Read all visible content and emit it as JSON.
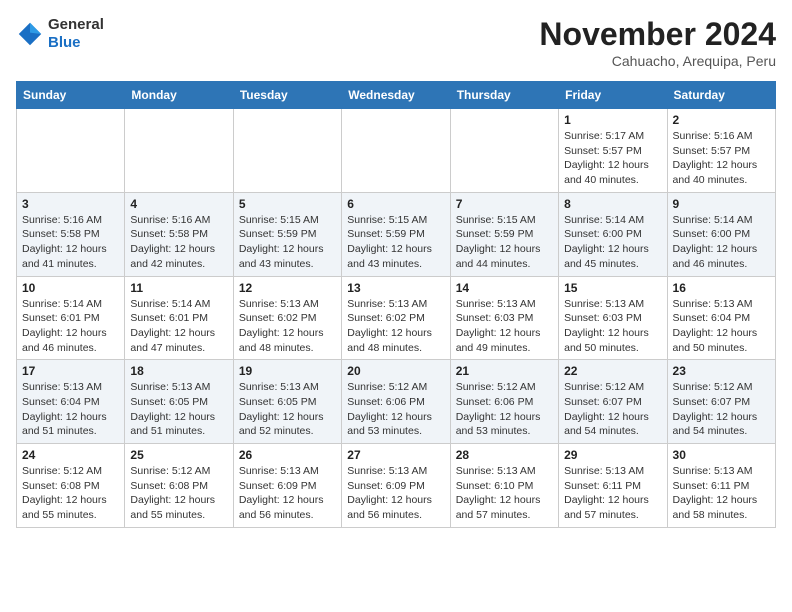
{
  "header": {
    "logo_general": "General",
    "logo_blue": "Blue",
    "month_year": "November 2024",
    "location": "Cahuacho, Arequipa, Peru"
  },
  "days_of_week": [
    "Sunday",
    "Monday",
    "Tuesday",
    "Wednesday",
    "Thursday",
    "Friday",
    "Saturday"
  ],
  "weeks": [
    [
      {
        "day": "",
        "info": ""
      },
      {
        "day": "",
        "info": ""
      },
      {
        "day": "",
        "info": ""
      },
      {
        "day": "",
        "info": ""
      },
      {
        "day": "",
        "info": ""
      },
      {
        "day": "1",
        "info": "Sunrise: 5:17 AM\nSunset: 5:57 PM\nDaylight: 12 hours\nand 40 minutes."
      },
      {
        "day": "2",
        "info": "Sunrise: 5:16 AM\nSunset: 5:57 PM\nDaylight: 12 hours\nand 40 minutes."
      }
    ],
    [
      {
        "day": "3",
        "info": "Sunrise: 5:16 AM\nSunset: 5:58 PM\nDaylight: 12 hours\nand 41 minutes."
      },
      {
        "day": "4",
        "info": "Sunrise: 5:16 AM\nSunset: 5:58 PM\nDaylight: 12 hours\nand 42 minutes."
      },
      {
        "day": "5",
        "info": "Sunrise: 5:15 AM\nSunset: 5:59 PM\nDaylight: 12 hours\nand 43 minutes."
      },
      {
        "day": "6",
        "info": "Sunrise: 5:15 AM\nSunset: 5:59 PM\nDaylight: 12 hours\nand 43 minutes."
      },
      {
        "day": "7",
        "info": "Sunrise: 5:15 AM\nSunset: 5:59 PM\nDaylight: 12 hours\nand 44 minutes."
      },
      {
        "day": "8",
        "info": "Sunrise: 5:14 AM\nSunset: 6:00 PM\nDaylight: 12 hours\nand 45 minutes."
      },
      {
        "day": "9",
        "info": "Sunrise: 5:14 AM\nSunset: 6:00 PM\nDaylight: 12 hours\nand 46 minutes."
      }
    ],
    [
      {
        "day": "10",
        "info": "Sunrise: 5:14 AM\nSunset: 6:01 PM\nDaylight: 12 hours\nand 46 minutes."
      },
      {
        "day": "11",
        "info": "Sunrise: 5:14 AM\nSunset: 6:01 PM\nDaylight: 12 hours\nand 47 minutes."
      },
      {
        "day": "12",
        "info": "Sunrise: 5:13 AM\nSunset: 6:02 PM\nDaylight: 12 hours\nand 48 minutes."
      },
      {
        "day": "13",
        "info": "Sunrise: 5:13 AM\nSunset: 6:02 PM\nDaylight: 12 hours\nand 48 minutes."
      },
      {
        "day": "14",
        "info": "Sunrise: 5:13 AM\nSunset: 6:03 PM\nDaylight: 12 hours\nand 49 minutes."
      },
      {
        "day": "15",
        "info": "Sunrise: 5:13 AM\nSunset: 6:03 PM\nDaylight: 12 hours\nand 50 minutes."
      },
      {
        "day": "16",
        "info": "Sunrise: 5:13 AM\nSunset: 6:04 PM\nDaylight: 12 hours\nand 50 minutes."
      }
    ],
    [
      {
        "day": "17",
        "info": "Sunrise: 5:13 AM\nSunset: 6:04 PM\nDaylight: 12 hours\nand 51 minutes."
      },
      {
        "day": "18",
        "info": "Sunrise: 5:13 AM\nSunset: 6:05 PM\nDaylight: 12 hours\nand 51 minutes."
      },
      {
        "day": "19",
        "info": "Sunrise: 5:13 AM\nSunset: 6:05 PM\nDaylight: 12 hours\nand 52 minutes."
      },
      {
        "day": "20",
        "info": "Sunrise: 5:12 AM\nSunset: 6:06 PM\nDaylight: 12 hours\nand 53 minutes."
      },
      {
        "day": "21",
        "info": "Sunrise: 5:12 AM\nSunset: 6:06 PM\nDaylight: 12 hours\nand 53 minutes."
      },
      {
        "day": "22",
        "info": "Sunrise: 5:12 AM\nSunset: 6:07 PM\nDaylight: 12 hours\nand 54 minutes."
      },
      {
        "day": "23",
        "info": "Sunrise: 5:12 AM\nSunset: 6:07 PM\nDaylight: 12 hours\nand 54 minutes."
      }
    ],
    [
      {
        "day": "24",
        "info": "Sunrise: 5:12 AM\nSunset: 6:08 PM\nDaylight: 12 hours\nand 55 minutes."
      },
      {
        "day": "25",
        "info": "Sunrise: 5:12 AM\nSunset: 6:08 PM\nDaylight: 12 hours\nand 55 minutes."
      },
      {
        "day": "26",
        "info": "Sunrise: 5:13 AM\nSunset: 6:09 PM\nDaylight: 12 hours\nand 56 minutes."
      },
      {
        "day": "27",
        "info": "Sunrise: 5:13 AM\nSunset: 6:09 PM\nDaylight: 12 hours\nand 56 minutes."
      },
      {
        "day": "28",
        "info": "Sunrise: 5:13 AM\nSunset: 6:10 PM\nDaylight: 12 hours\nand 57 minutes."
      },
      {
        "day": "29",
        "info": "Sunrise: 5:13 AM\nSunset: 6:11 PM\nDaylight: 12 hours\nand 57 minutes."
      },
      {
        "day": "30",
        "info": "Sunrise: 5:13 AM\nSunset: 6:11 PM\nDaylight: 12 hours\nand 58 minutes."
      }
    ]
  ]
}
